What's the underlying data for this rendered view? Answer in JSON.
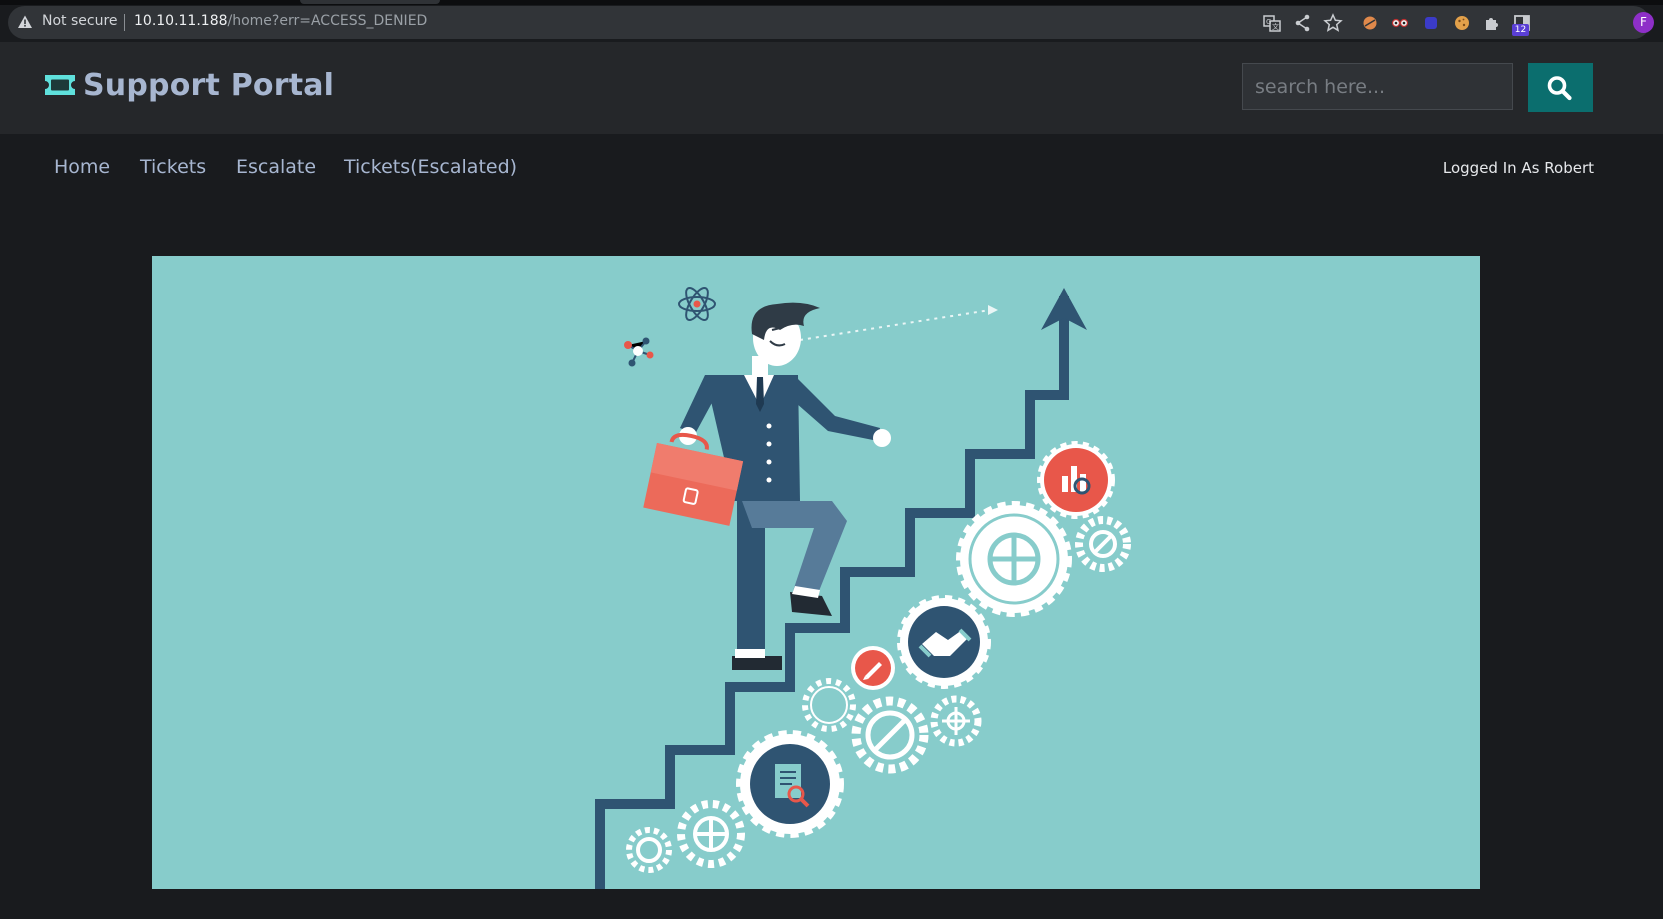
{
  "browser": {
    "security_label": "Not secure",
    "url_host": "10.10.11.188",
    "url_path": "/home?err=ACCESS_DENIED",
    "extension_badge": "12",
    "profile_initial": "F"
  },
  "header": {
    "brand": "Support Portal",
    "search_placeholder": "search here..."
  },
  "nav": {
    "items": [
      {
        "label": "Home"
      },
      {
        "label": "Tickets"
      },
      {
        "label": "Escalate"
      },
      {
        "label": "Tickets(Escalated)"
      }
    ],
    "logged_in": "Logged In As Robert"
  },
  "colors": {
    "accent": "#0b6e6e",
    "brand_text": "#a7b6d0",
    "logo": "#5fe0dc",
    "hero_bg": "#87cccb"
  },
  "hero": {
    "illustration": "businessman-climbing-stairs-with-gears"
  }
}
